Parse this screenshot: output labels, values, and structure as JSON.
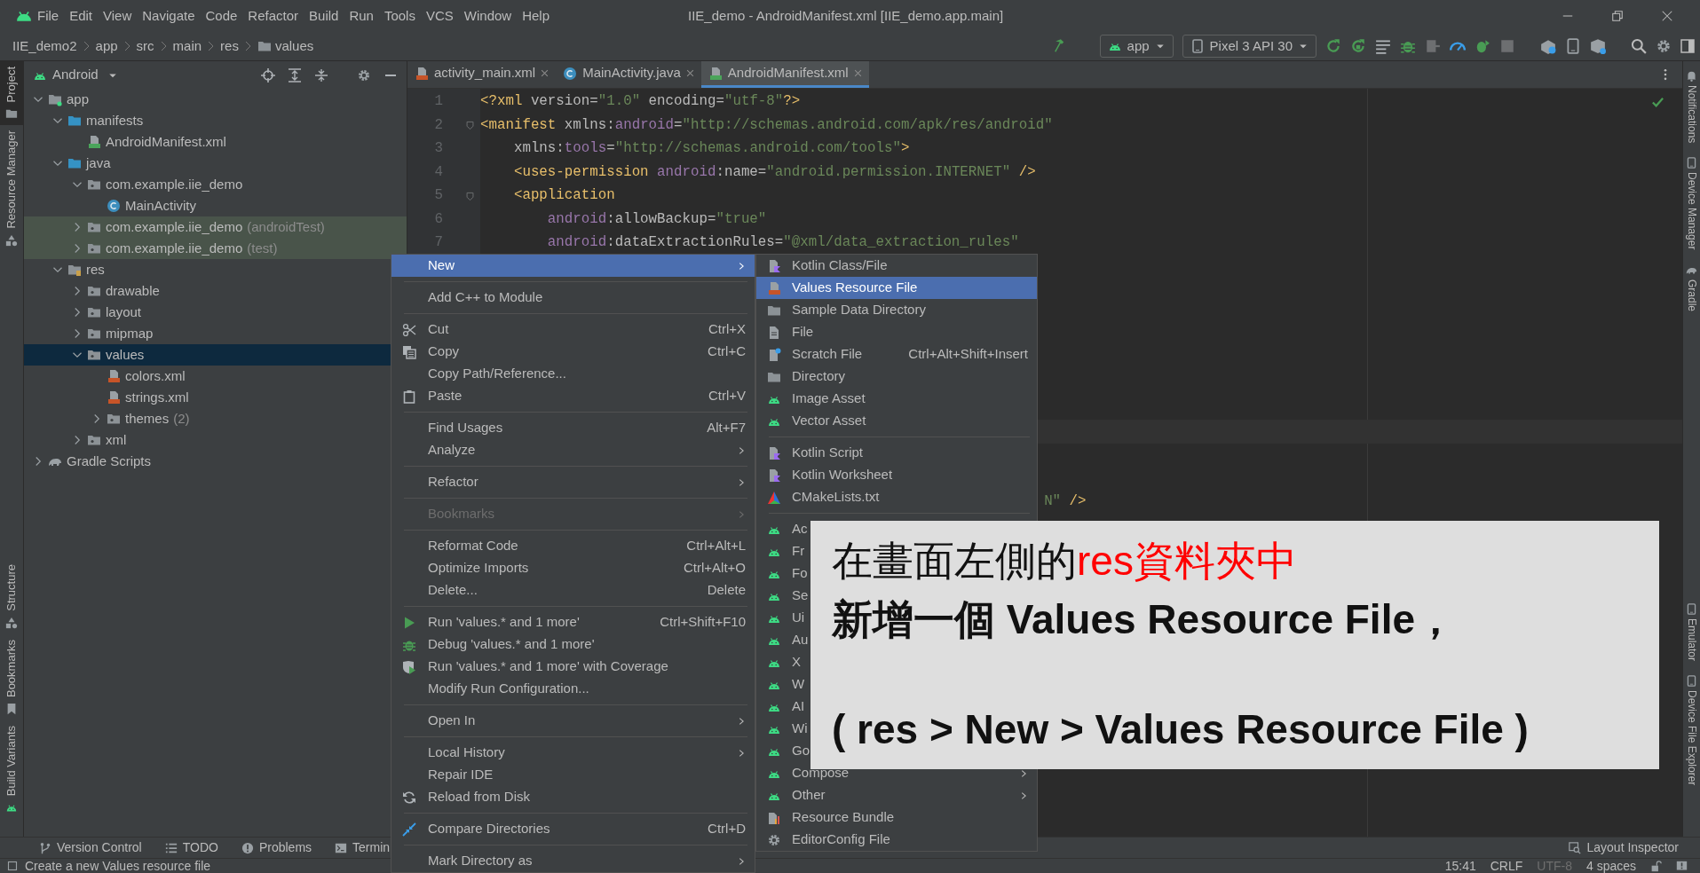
{
  "menu_bar": {
    "items": [
      "File",
      "Edit",
      "View",
      "Navigate",
      "Code",
      "Refactor",
      "Build",
      "Run",
      "Tools",
      "VCS",
      "Window",
      "Help"
    ],
    "title": "IIE_demo - AndroidManifest.xml [IIE_demo.app.main]"
  },
  "navigation_bar": {
    "breadcrumbs": [
      "IIE_demo2",
      "app",
      "src",
      "main",
      "res",
      "values"
    ],
    "run_config": "app",
    "device": "Pixel 3 API 30"
  },
  "left_tool_strip": {
    "top": [
      {
        "label": "Project",
        "selected": true
      },
      {
        "label": "Resource Manager",
        "selected": false
      }
    ],
    "bottom": [
      {
        "label": "Structure",
        "selected": false
      },
      {
        "label": "Bookmarks",
        "selected": false
      },
      {
        "label": "Build Variants",
        "selected": false
      }
    ]
  },
  "project_panel": {
    "view": "Android",
    "tree": [
      {
        "label": "app",
        "kind": "module",
        "expanded": true,
        "selected": false,
        "test_scope": false,
        "children": [
          {
            "label": "manifests",
            "kind": "source_folder",
            "expanded": true,
            "selected": false,
            "test_scope": false,
            "children": [
              {
                "label": "AndroidManifest.xml",
                "kind": "manifest",
                "selected": false,
                "test_scope": false
              }
            ]
          },
          {
            "label": "java",
            "kind": "source_folder",
            "expanded": true,
            "selected": false,
            "test_scope": false,
            "children": [
              {
                "label": "com.example.iie_demo",
                "kind": "package",
                "expanded": true,
                "selected": false,
                "test_scope": false,
                "children": [
                  {
                    "label": "MainActivity",
                    "kind": "class",
                    "selected": false,
                    "test_scope": false
                  }
                ]
              },
              {
                "label": "com.example.iie_demo",
                "note": "(androidTest)",
                "kind": "package",
                "expanded": false,
                "selected": false,
                "test_scope": true
              },
              {
                "label": "com.example.iie_demo",
                "note": "(test)",
                "kind": "package",
                "expanded": false,
                "selected": false,
                "test_scope": true
              }
            ]
          },
          {
            "label": "res",
            "kind": "res_folder",
            "expanded": true,
            "selected": false,
            "test_scope": false,
            "children": [
              {
                "label": "drawable",
                "kind": "package",
                "expanded": false,
                "selected": false,
                "test_scope": false
              },
              {
                "label": "layout",
                "kind": "package",
                "expanded": false,
                "selected": false,
                "test_scope": false
              },
              {
                "label": "mipmap",
                "kind": "package",
                "expanded": false,
                "selected": false,
                "test_scope": false
              },
              {
                "label": "values",
                "kind": "package",
                "expanded": true,
                "selected": true,
                "test_scope": false,
                "children": [
                  {
                    "label": "colors.xml",
                    "kind": "xml",
                    "selected": false,
                    "test_scope": false
                  },
                  {
                    "label": "strings.xml",
                    "kind": "xml",
                    "selected": false,
                    "test_scope": false
                  },
                  {
                    "label": "themes",
                    "note": "(2)",
                    "kind": "package",
                    "expanded": false,
                    "selected": false,
                    "test_scope": false
                  }
                ]
              },
              {
                "label": "xml",
                "kind": "package",
                "expanded": false,
                "selected": false,
                "test_scope": false
              }
            ]
          }
        ]
      },
      {
        "label": "Gradle Scripts",
        "kind": "gradle",
        "expanded": false,
        "selected": false,
        "test_scope": false
      }
    ]
  },
  "editor": {
    "tabs": [
      {
        "label": "activity_main.xml",
        "kind": "xml",
        "selected": false
      },
      {
        "label": "MainActivity.java",
        "kind": "class",
        "selected": false
      },
      {
        "label": "AndroidManifest.xml",
        "kind": "manifest",
        "selected": true
      }
    ],
    "lines": [
      {
        "number": "1",
        "fold": false,
        "tokens": [
          {
            "kind": "tag",
            "text": "<?xml "
          },
          {
            "kind": "attr",
            "text": "version="
          },
          {
            "kind": "str",
            "text": "\"1.0\""
          },
          {
            "kind": "attr",
            "text": " encoding="
          },
          {
            "kind": "str",
            "text": "\"utf-8\""
          },
          {
            "kind": "tag",
            "text": "?>"
          }
        ]
      },
      {
        "number": "2",
        "fold": true,
        "tokens": [
          {
            "kind": "tag",
            "text": "<manifest "
          },
          {
            "kind": "attr",
            "text": "xmlns:"
          },
          {
            "kind": "ns",
            "text": "android"
          },
          {
            "kind": "attr",
            "text": "="
          },
          {
            "kind": "str",
            "text": "\"http://schemas.android.com/apk/res/android\""
          }
        ]
      },
      {
        "number": "3",
        "fold": false,
        "tokens": [
          {
            "kind": "attr",
            "text": "    xmlns:"
          },
          {
            "kind": "ns",
            "text": "tools"
          },
          {
            "kind": "attr",
            "text": "="
          },
          {
            "kind": "str",
            "text": "\"http://schemas.android.com/tools\""
          },
          {
            "kind": "tag",
            "text": ">"
          }
        ]
      },
      {
        "number": "4",
        "fold": false,
        "tokens": [
          {
            "kind": "tag",
            "text": "    <uses-permission "
          },
          {
            "kind": "ns",
            "text": "android"
          },
          {
            "kind": "attr",
            "text": ":name="
          },
          {
            "kind": "str",
            "text": "\"android.permission.INTERNET\""
          },
          {
            "kind": "tag",
            "text": " />"
          }
        ]
      },
      {
        "number": "5",
        "fold": true,
        "tokens": [
          {
            "kind": "tag",
            "text": "    <application"
          }
        ]
      },
      {
        "number": "6",
        "fold": false,
        "tokens": [
          {
            "kind": "ns",
            "text": "        android"
          },
          {
            "kind": "attr",
            "text": ":allowBackup="
          },
          {
            "kind": "str",
            "text": "\"true\""
          }
        ]
      },
      {
        "number": "7",
        "fold": false,
        "tokens": [
          {
            "kind": "ns",
            "text": "        android"
          },
          {
            "kind": "attr",
            "text": ":dataExtractionRules="
          },
          {
            "kind": "str",
            "text": "\"@xml/data_extraction_rules\""
          }
        ]
      }
    ],
    "current_line_highlight": true,
    "fragment": {
      "tokens": [
        {
          "kind": "str",
          "text": "                                                                   N\""
        },
        {
          "kind": "tag",
          "text": " />"
        }
      ]
    }
  },
  "right_tool_strip": {
    "top": [
      "Notifications",
      "Device Manager",
      "Gradle"
    ],
    "bottom": [
      "Emulator",
      "Device File Explorer"
    ]
  },
  "context_menu": {
    "items": [
      {
        "kind": "plain",
        "label": "New",
        "submenu": true,
        "selected": true,
        "disabled": false
      },
      {
        "kind": "separator"
      },
      {
        "kind": "plain",
        "label": "Add C++ to Module",
        "submenu": false,
        "selected": false,
        "disabled": false
      },
      {
        "kind": "separator"
      },
      {
        "kind": "cut",
        "label": "Cut",
        "shortcut": "Ctrl+X",
        "submenu": false,
        "selected": false,
        "disabled": false
      },
      {
        "kind": "copy",
        "label": "Copy",
        "shortcut": "Ctrl+C",
        "submenu": false,
        "selected": false,
        "disabled": false
      },
      {
        "kind": "plain",
        "label": "Copy Path/Reference...",
        "submenu": false,
        "selected": false,
        "disabled": false
      },
      {
        "kind": "paste",
        "label": "Paste",
        "shortcut": "Ctrl+V",
        "submenu": false,
        "selected": false,
        "disabled": false
      },
      {
        "kind": "separator"
      },
      {
        "kind": "plain",
        "label": "Find Usages",
        "shortcut": "Alt+F7",
        "submenu": false,
        "selected": false,
        "disabled": false
      },
      {
        "kind": "plain",
        "label": "Analyze",
        "submenu": true,
        "selected": false,
        "disabled": false
      },
      {
        "kind": "separator"
      },
      {
        "kind": "plain",
        "label": "Refactor",
        "submenu": true,
        "selected": false,
        "disabled": false
      },
      {
        "kind": "separator"
      },
      {
        "kind": "plain",
        "label": "Bookmarks",
        "submenu": true,
        "selected": false,
        "disabled": true
      },
      {
        "kind": "separator"
      },
      {
        "kind": "plain",
        "label": "Reformat Code",
        "shortcut": "Ctrl+Alt+L",
        "submenu": false,
        "selected": false,
        "disabled": false
      },
      {
        "kind": "plain",
        "label": "Optimize Imports",
        "shortcut": "Ctrl+Alt+O",
        "submenu": false,
        "selected": false,
        "disabled": false
      },
      {
        "kind": "plain",
        "label": "Delete...",
        "shortcut": "Delete",
        "submenu": false,
        "selected": false,
        "disabled": false
      },
      {
        "kind": "separator"
      },
      {
        "kind": "run",
        "label": "Run 'values.* and 1 more'",
        "shortcut": "Ctrl+Shift+F10",
        "submenu": false,
        "selected": false,
        "disabled": false
      },
      {
        "kind": "debug",
        "label": "Debug 'values.* and 1 more'",
        "submenu": false,
        "selected": false,
        "disabled": false
      },
      {
        "kind": "coverage",
        "label": "Run 'values.* and 1 more' with Coverage",
        "submenu": false,
        "selected": false,
        "disabled": false
      },
      {
        "kind": "plain",
        "label": "Modify Run Configuration...",
        "submenu": false,
        "selected": false,
        "disabled": false
      },
      {
        "kind": "separator"
      },
      {
        "kind": "plain",
        "label": "Open In",
        "submenu": true,
        "selected": false,
        "disabled": false
      },
      {
        "kind": "separator"
      },
      {
        "kind": "plain",
        "label": "Local History",
        "submenu": true,
        "selected": false,
        "disabled": false
      },
      {
        "kind": "plain",
        "label": "Repair IDE",
        "submenu": false,
        "selected": false,
        "disabled": false
      },
      {
        "kind": "reload",
        "label": "Reload from Disk",
        "submenu": false,
        "selected": false,
        "disabled": false
      },
      {
        "kind": "separator"
      },
      {
        "kind": "compare",
        "label": "Compare Directories",
        "shortcut": "Ctrl+D",
        "submenu": false,
        "selected": false,
        "disabled": false
      },
      {
        "kind": "separator"
      },
      {
        "kind": "plain",
        "label": "Mark Directory as",
        "submenu": true,
        "selected": false,
        "disabled": false
      }
    ]
  },
  "submenu": {
    "items": [
      {
        "kind": "kotlin",
        "label": "Kotlin Class/File",
        "submenu": false,
        "selected": false
      },
      {
        "kind": "xml",
        "label": "Values Resource File",
        "submenu": false,
        "selected": true
      },
      {
        "kind": "folder",
        "label": "Sample Data Directory",
        "submenu": false,
        "selected": false
      },
      {
        "kind": "file",
        "label": "File",
        "submenu": false,
        "selected": false
      },
      {
        "kind": "scratch",
        "label": "Scratch File",
        "shortcut": "Ctrl+Alt+Shift+Insert",
        "submenu": false,
        "selected": false
      },
      {
        "kind": "folder",
        "label": "Directory",
        "submenu": false,
        "selected": false
      },
      {
        "kind": "android",
        "label": "Image Asset",
        "submenu": false,
        "selected": false
      },
      {
        "kind": "android",
        "label": "Vector Asset",
        "submenu": false,
        "selected": false
      },
      {
        "kind": "separator"
      },
      {
        "kind": "kotlin",
        "label": "Kotlin Script",
        "submenu": false,
        "selected": false
      },
      {
        "kind": "kotlin",
        "label": "Kotlin Worksheet",
        "submenu": false,
        "selected": false
      },
      {
        "kind": "cmake",
        "label": "CMakeLists.txt",
        "submenu": false,
        "selected": false
      },
      {
        "kind": "separator"
      },
      {
        "kind": "android",
        "label": "Ac",
        "selected": false
      },
      {
        "kind": "android",
        "label": "Fr",
        "selected": false
      },
      {
        "kind": "android",
        "label": "Fo",
        "selected": false
      },
      {
        "kind": "android",
        "label": "Se",
        "selected": false
      },
      {
        "kind": "android",
        "label": "Ui",
        "selected": false
      },
      {
        "kind": "android",
        "label": "Au",
        "selected": false
      },
      {
        "kind": "android",
        "label": "X",
        "selected": false
      },
      {
        "kind": "android",
        "label": "W",
        "selected": false
      },
      {
        "kind": "android",
        "label": "AI",
        "selected": false
      },
      {
        "kind": "android",
        "label": "Wi",
        "selected": false
      },
      {
        "kind": "android",
        "label": "Go",
        "selected": false
      },
      {
        "kind": "android",
        "label": "Compose",
        "submenu": true,
        "selected": false
      },
      {
        "kind": "android",
        "label": "Other",
        "submenu": true,
        "selected": false
      },
      {
        "kind": "bundle",
        "label": "Resource Bundle",
        "submenu": false,
        "selected": false
      },
      {
        "kind": "gear",
        "label": "EditorConfig File",
        "submenu": false,
        "selected": false
      }
    ]
  },
  "annotation": {
    "lines": [
      {
        "bold": false,
        "parts": [
          {
            "text": "在畫面左側的",
            "color": "#111111"
          },
          {
            "text": "res資料夾中",
            "color": "#ff0000"
          }
        ]
      },
      {
        "bold": true,
        "parts": [
          {
            "text": "新增一個 Values Resource File，",
            "color": "#111111"
          }
        ]
      },
      {
        "bold": true,
        "parts": [
          {
            "text": "( res > New > Values Resource File )",
            "color": "#111111"
          }
        ]
      }
    ]
  },
  "bottom_tool_bar": {
    "tabs": [
      "Version Control",
      "TODO",
      "Problems",
      "Termin"
    ],
    "right": "Layout Inspector"
  },
  "status_bar": {
    "message": "Create a new Values resource file",
    "items": [
      {
        "text": "15:41",
        "dimmed": false
      },
      {
        "text": "CRLF",
        "dimmed": false
      },
      {
        "text": "UTF-8",
        "dimmed": true
      },
      {
        "text": "4 spaces",
        "dimmed": false
      }
    ]
  }
}
